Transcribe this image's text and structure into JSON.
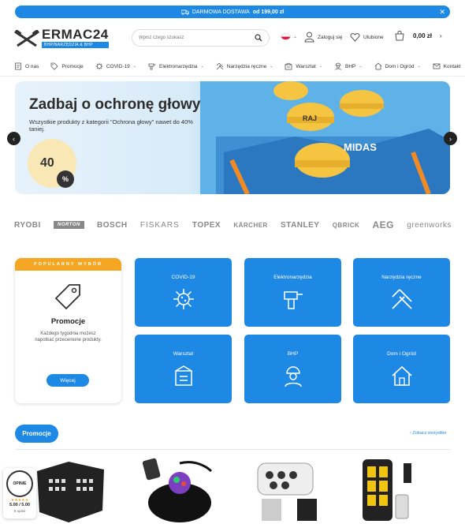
{
  "topbar": {
    "text": "DARMOWA DOSTAWA",
    "amount": "od 199,00 zł",
    "close": "✕"
  },
  "logo": {
    "name": "ERMAC24",
    "tagline": "BHP/NARZĘDZIA & BHP"
  },
  "search": {
    "placeholder": "Wpisz czego szukasz"
  },
  "header": {
    "login": "Zaloguj się",
    "favorites": "Ulubione",
    "cart_total": "0,00 zł"
  },
  "nav": {
    "items": [
      {
        "label": "O nas",
        "icon": "document-icon",
        "chevron": false
      },
      {
        "label": "Promocje",
        "icon": "tag-icon",
        "chevron": false
      },
      {
        "label": "COVID-19",
        "icon": "virus-icon",
        "chevron": true
      },
      {
        "label": "Elektronarzędzia",
        "icon": "drill-icon",
        "chevron": true
      },
      {
        "label": "Narzędzia ręczne",
        "icon": "tools-icon",
        "chevron": true
      },
      {
        "label": "Warsztat",
        "icon": "workshop-icon",
        "chevron": true
      },
      {
        "label": "BHP",
        "icon": "worker-icon",
        "chevron": true
      },
      {
        "label": "Dom i Ogród",
        "icon": "house-icon",
        "chevron": true
      },
      {
        "label": "Kontakt",
        "icon": "contact-icon",
        "chevron": false
      }
    ]
  },
  "hero": {
    "title": "Zadbaj o ochronę głowy",
    "subtitle": "Wszystkie produkty z kategorii \"Ochrona głowy\" nawet do 40% taniej.",
    "discount": "40",
    "percent": "%",
    "helmet_texts": [
      "RAJ",
      "MIDAS"
    ]
  },
  "brands": [
    "RYOBI",
    "NORTON",
    "BOSCH",
    "FISKARS",
    "TOPEX",
    "KÄRCHER",
    "STANLEY",
    "QBRICK",
    "AEG",
    "greenworks"
  ],
  "promo_card": {
    "ribbon": "POPULARNY WYBÓR",
    "title": "Promocje",
    "text": "Każdego tygodnia możesz napotkać przecenione produkty.",
    "button": "Więcej"
  },
  "tiles": [
    {
      "label": "COVID-19",
      "icon": "virus-icon"
    },
    {
      "label": "Elektronarzędzia",
      "icon": "drill-icon"
    },
    {
      "label": "Narzędzia ręczne",
      "icon": "tools-icon"
    },
    {
      "label": "Warsztat",
      "icon": "workshop-icon"
    },
    {
      "label": "BHP",
      "icon": "worker-icon"
    },
    {
      "label": "Dom i Ogród",
      "icon": "house-icon"
    }
  ],
  "section": {
    "title": "Promocje",
    "see_all": "› Zobacz wszystkie"
  },
  "rating": {
    "badge": "OPINIE",
    "stars": "★★★★★",
    "score": "5.00 / 5.00",
    "count": "5 opinii"
  },
  "colors": {
    "accent": "#1e88e5",
    "ribbon": "#f5a623"
  }
}
